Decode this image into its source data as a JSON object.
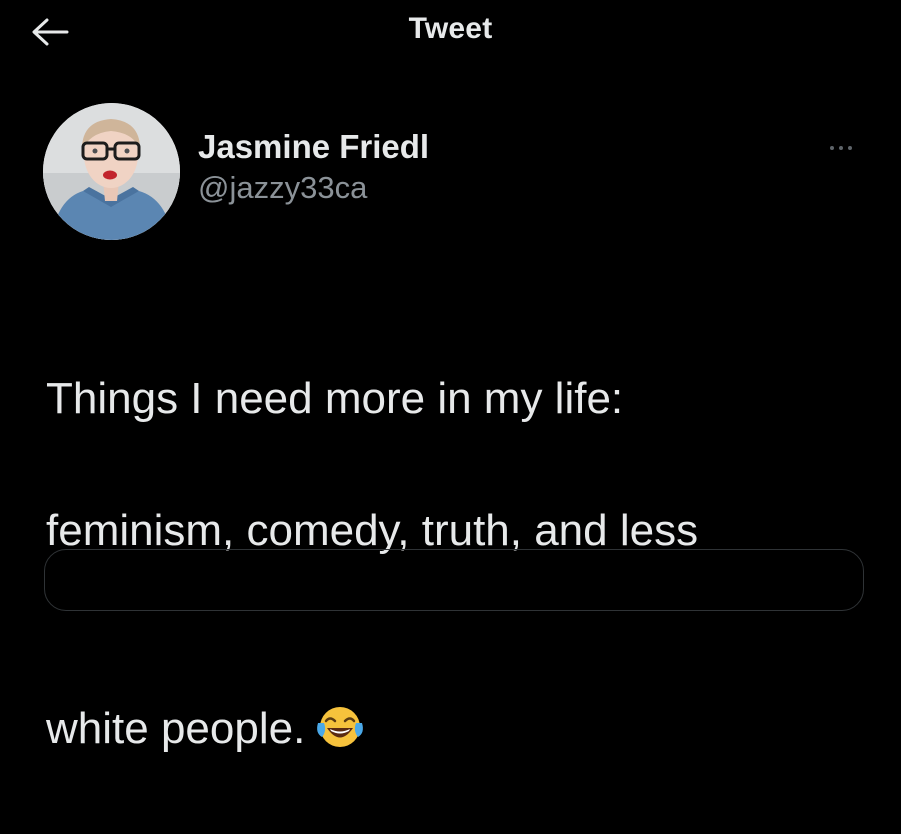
{
  "header": {
    "title": "Tweet",
    "back_icon": "arrow-left-icon"
  },
  "author": {
    "display_name": "Jasmine Friedl",
    "handle": "@jazzy33ca"
  },
  "tweet": {
    "line1": "Things I need more in my life:",
    "line2": "feminism, comedy, truth, and less",
    "line3": "white people.",
    "emoji": "face-with-tears-of-joy-icon"
  },
  "menu": {
    "icon": "more-options-icon"
  },
  "colors": {
    "background": "#000000",
    "primary_text": "#e7e9ea",
    "secondary_text": "#8b9298",
    "border": "#2f3336"
  }
}
